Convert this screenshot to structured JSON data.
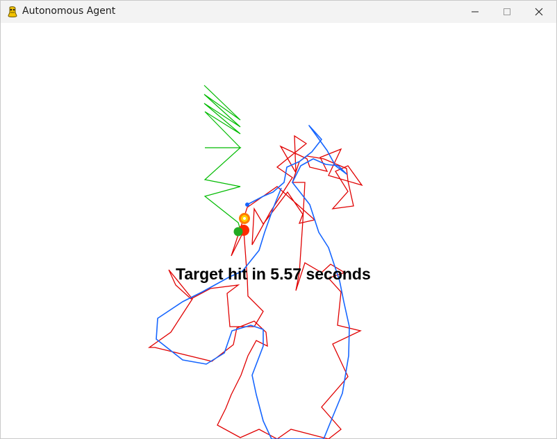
{
  "window": {
    "title": "Autonomous Agent",
    "app_icon": "pygame-snake-icon",
    "controls": [
      "minimize-icon",
      "maximize-icon",
      "close-icon"
    ]
  },
  "game": {
    "status_message": "Target hit in 5.57 seconds",
    "colors": {
      "background": "#ffffff",
      "agent_path": "#1565ff",
      "red_trail": "#e00000",
      "green_trail": "#00bb00",
      "target": "#ff2a00",
      "green_agent": "#22aa22",
      "hit_flash": "#ff9a00"
    }
  }
}
